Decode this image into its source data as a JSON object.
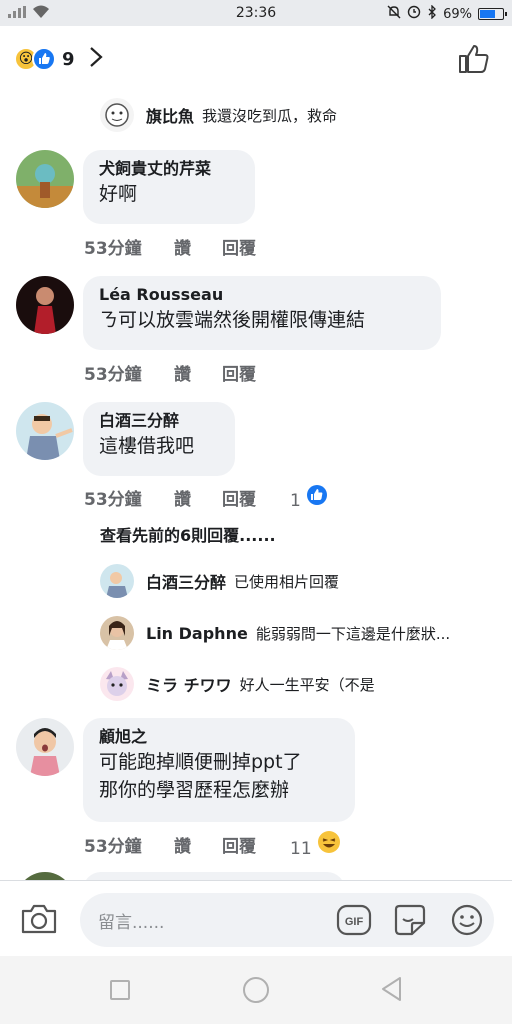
{
  "status_bar": {
    "time": "23:36",
    "battery": "69%",
    "battery_level": 0.69
  },
  "header": {
    "reaction_count": "9",
    "reaction_icons": [
      "wow-emoji-icon",
      "like-reaction-icon"
    ]
  },
  "top_reply": {
    "name": "旗比魚",
    "text": "我還沒吃到瓜，救命"
  },
  "comments": [
    {
      "name": "犬飼貴丈的芹菜",
      "lines": [
        "好啊"
      ],
      "time": "53分鐘",
      "like": "讚",
      "reply": "回覆",
      "reactions": ""
    },
    {
      "name": "Léa Rousseau",
      "lines": [
        "ㄋ可以放雲端然後開權限傳連結"
      ],
      "time": "53分鐘",
      "like": "讚",
      "reply": "回覆",
      "reactions": ""
    },
    {
      "name": "白酒三分醉",
      "lines": [
        "這樓借我吧"
      ],
      "time": "53分鐘",
      "like": "讚",
      "reply": "回覆",
      "reactions": "1"
    },
    {
      "name": "顧旭之",
      "lines": [
        "可能跑掉順便刪掉ppt了",
        "那你的學習歷程怎麼辦"
      ],
      "time": "53分鐘",
      "like": "讚",
      "reply": "回覆",
      "reactions": "11"
    }
  ],
  "view_previous": "查看先前的6則回覆......",
  "replies": [
    {
      "name": "白酒三分醉",
      "text": "已使用相片回覆"
    },
    {
      "name": "Lin Daphne",
      "text": "能弱弱問一下這邊是什麼狀..."
    },
    {
      "name": "ミラ チワワ",
      "text": "好人一生平安（不是"
    }
  ],
  "composer": {
    "placeholder": "留言......",
    "gif_label": "GIF"
  },
  "colors": {
    "accent": "#1877f2",
    "bubble": "#f0f2f5",
    "meta": "#65676b"
  }
}
